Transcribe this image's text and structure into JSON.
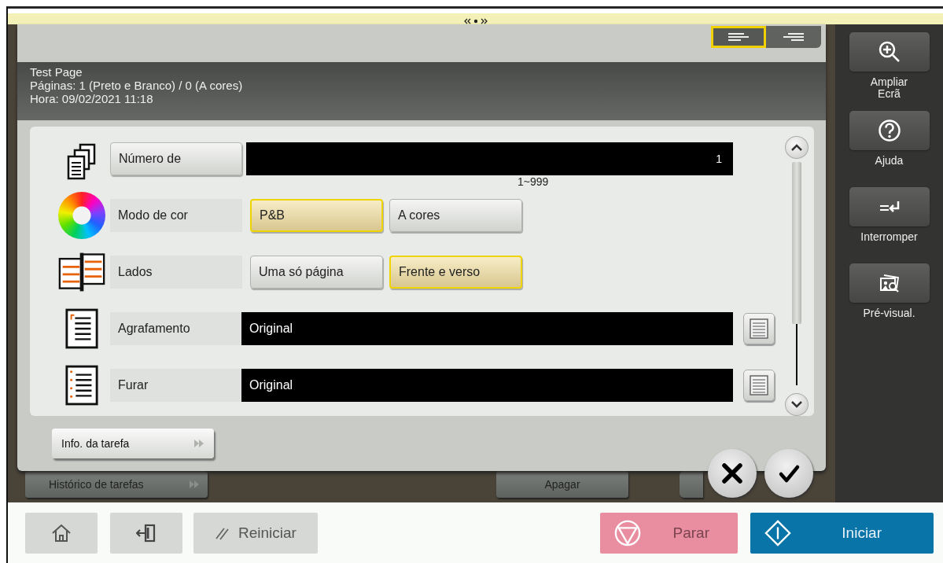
{
  "view_toggle": [
    {
      "kind": "left",
      "selected": true
    },
    {
      "kind": "right",
      "selected": false
    }
  ],
  "job": {
    "title": "Test Page",
    "pages": "Páginas: 1 (Preto e Branco) / 0 (A cores)",
    "time": "Hora: 09/02/2021 11:18"
  },
  "settings": [
    {
      "kind": "number",
      "label": "Número de",
      "value": "1",
      "hint": "1~999"
    },
    {
      "kind": "options",
      "label": "Modo de cor",
      "options": [
        {
          "label": "P&B",
          "selected": true
        },
        {
          "label": "A cores",
          "selected": false
        }
      ]
    },
    {
      "kind": "options",
      "label": "Lados",
      "options": [
        {
          "label": "Uma só página",
          "selected": false
        },
        {
          "label": "Frente e verso",
          "selected": true
        }
      ]
    },
    {
      "kind": "select",
      "label": "Agrafamento",
      "value": "Original"
    },
    {
      "kind": "select",
      "label": "Furar",
      "value": "Original"
    }
  ],
  "info_button": "Info. da tarefa",
  "background_buttons": [
    {
      "kind": "history",
      "label": "Histórico de tarefas"
    },
    {
      "kind": "delete",
      "label": "Apagar"
    }
  ],
  "side_buttons": [
    {
      "kind": "zoom",
      "label": "Ampliar Ecrã"
    },
    {
      "kind": "help",
      "label": "Ajuda"
    },
    {
      "kind": "interrupt",
      "label": "Interromper"
    },
    {
      "kind": "preview",
      "label": "Pré-visual."
    }
  ],
  "bottom_buttons": [
    {
      "kind": "home"
    },
    {
      "kind": "exit"
    },
    {
      "kind": "reset",
      "label": "Reiniciar"
    },
    {
      "kind": "stop",
      "label": "Parar"
    },
    {
      "kind": "start",
      "label": "Iniciar"
    }
  ]
}
